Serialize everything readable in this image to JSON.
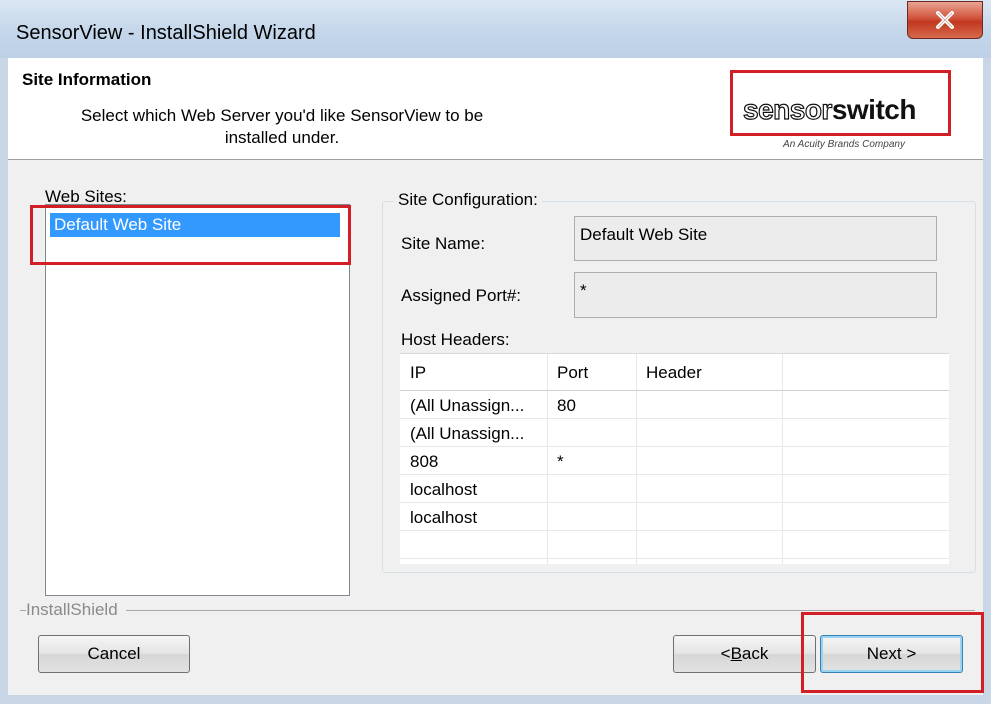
{
  "window": {
    "title": "SensorView - InstallShield Wizard",
    "close_icon": "close-icon"
  },
  "header": {
    "title": "Site Information",
    "description": "Select which Web Server you'd like SensorView to be installed under.",
    "logo_white": "sensor",
    "logo_black": "switch",
    "logo_tagline": "An Acuity Brands Company"
  },
  "web_sites": {
    "label": "Web Sites:",
    "items": [
      "Default Web Site"
    ],
    "selected": "Default Web Site"
  },
  "site_config": {
    "group_label": "Site Configuration:",
    "site_name_label": "Site Name:",
    "site_name_value": "Default Web Site",
    "port_label": "Assigned Port#:",
    "port_value": "*",
    "host_headers_label": "Host Headers:",
    "columns": [
      "IP",
      "Port",
      "Header"
    ],
    "rows": [
      [
        "(All Unassign...",
        "80",
        ""
      ],
      [
        "(All Unassign...",
        "",
        ""
      ],
      [
        "808",
        "*",
        ""
      ],
      [
        "localhost",
        "",
        ""
      ],
      [
        "localhost",
        "",
        ""
      ]
    ]
  },
  "footer": {
    "brand": "InstallShield",
    "cancel_label": "Cancel",
    "back_prefix": "< ",
    "back_underline": "B",
    "back_rest": "ack",
    "next_label": "Next >"
  },
  "colors": {
    "highlight": "#d21f26",
    "selection": "#3399ff"
  }
}
